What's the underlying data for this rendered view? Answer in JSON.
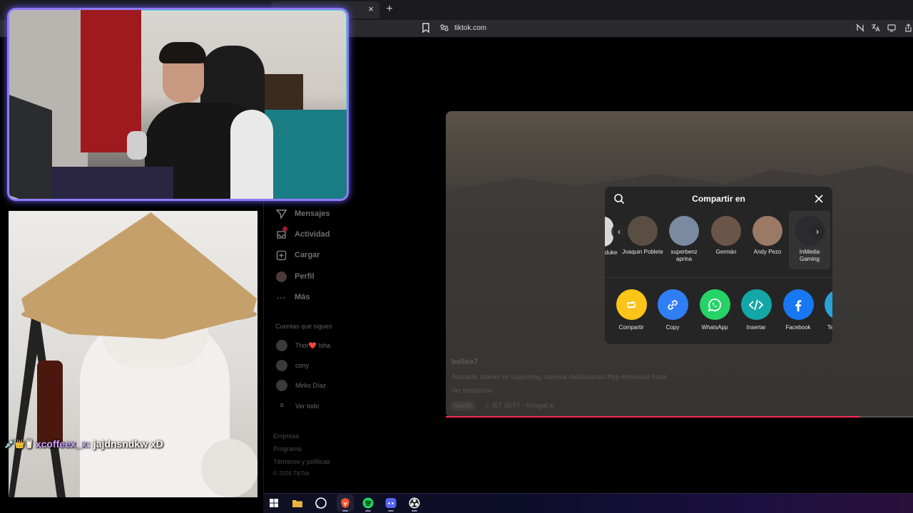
{
  "browser": {
    "url": "tiktok.com",
    "close_tab_glyph": "×",
    "new_tab_glyph": "+",
    "toolbar_icons": [
      "no-tracking-icon",
      "translate-icon",
      "cast-icon",
      "share-icon"
    ]
  },
  "sidebar": {
    "items": [
      {
        "label": "Mensajes",
        "icon": "send-icon"
      },
      {
        "label": "Actividad",
        "icon": "inbox-icon"
      },
      {
        "label": "Cargar",
        "icon": "upload-icon"
      },
      {
        "label": "Perfil",
        "icon": "profile-icon"
      },
      {
        "label": "Más",
        "icon": "more-icon"
      }
    ],
    "following_header": "Cuentas que sigues",
    "following": [
      {
        "name": "Thor❤️ Isha"
      },
      {
        "name": "cony"
      },
      {
        "name": "Mirko Díaz"
      }
    ],
    "see_all": "Ver todo",
    "footer_links": [
      "Empresa",
      "Programa",
      "Términos y políticas"
    ],
    "copyright": "© 2026 TikTok"
  },
  "video": {
    "author": "bellee7",
    "caption": "Adorable, thanks for supporting. #animal #wildanimals #fyp #inthewild #seal",
    "translation": "Ver traducción",
    "spotify": "Spotify",
    "music": "JET SET!! - Xmegal.xl"
  },
  "share_modal": {
    "title": "Compartir en",
    "partial_friend": "duke",
    "friends": [
      {
        "name": "Joaquin Poblete",
        "color": "#5a4e44"
      },
      {
        "name": "superbenz aprina",
        "color": "#7a8aa0"
      },
      {
        "name": "Germán",
        "color": "#6b5548"
      },
      {
        "name": "Andy Pezo",
        "color": "#9a7a64"
      },
      {
        "name": "InMedia Gaming",
        "color": "#2b2b30"
      }
    ],
    "options": [
      {
        "label": "Compartir",
        "color": "#fcc419",
        "icon": "repost-icon"
      },
      {
        "label": "Copy",
        "color": "#2f7ef5",
        "icon": "link-icon"
      },
      {
        "label": "WhatsApp",
        "color": "#25d366",
        "icon": "whatsapp-icon"
      },
      {
        "label": "Insertar",
        "color": "#13a7a8",
        "icon": "embed-icon"
      },
      {
        "label": "Facebook",
        "color": "#1877f2",
        "icon": "facebook-icon"
      },
      {
        "label": "Te",
        "color": "#2aa1d8",
        "icon": "telegram-icon"
      }
    ]
  },
  "chat": {
    "badges": "💉👑🥛",
    "username": "xcoffeex_x:",
    "message": "jajdnsndkw xD"
  },
  "taskbar": {
    "apps": [
      "windows-start-icon",
      "file-explorer-icon",
      "whatsapp-icon",
      "brave-icon",
      "spotify-icon",
      "discord-icon",
      "obs-icon"
    ]
  }
}
